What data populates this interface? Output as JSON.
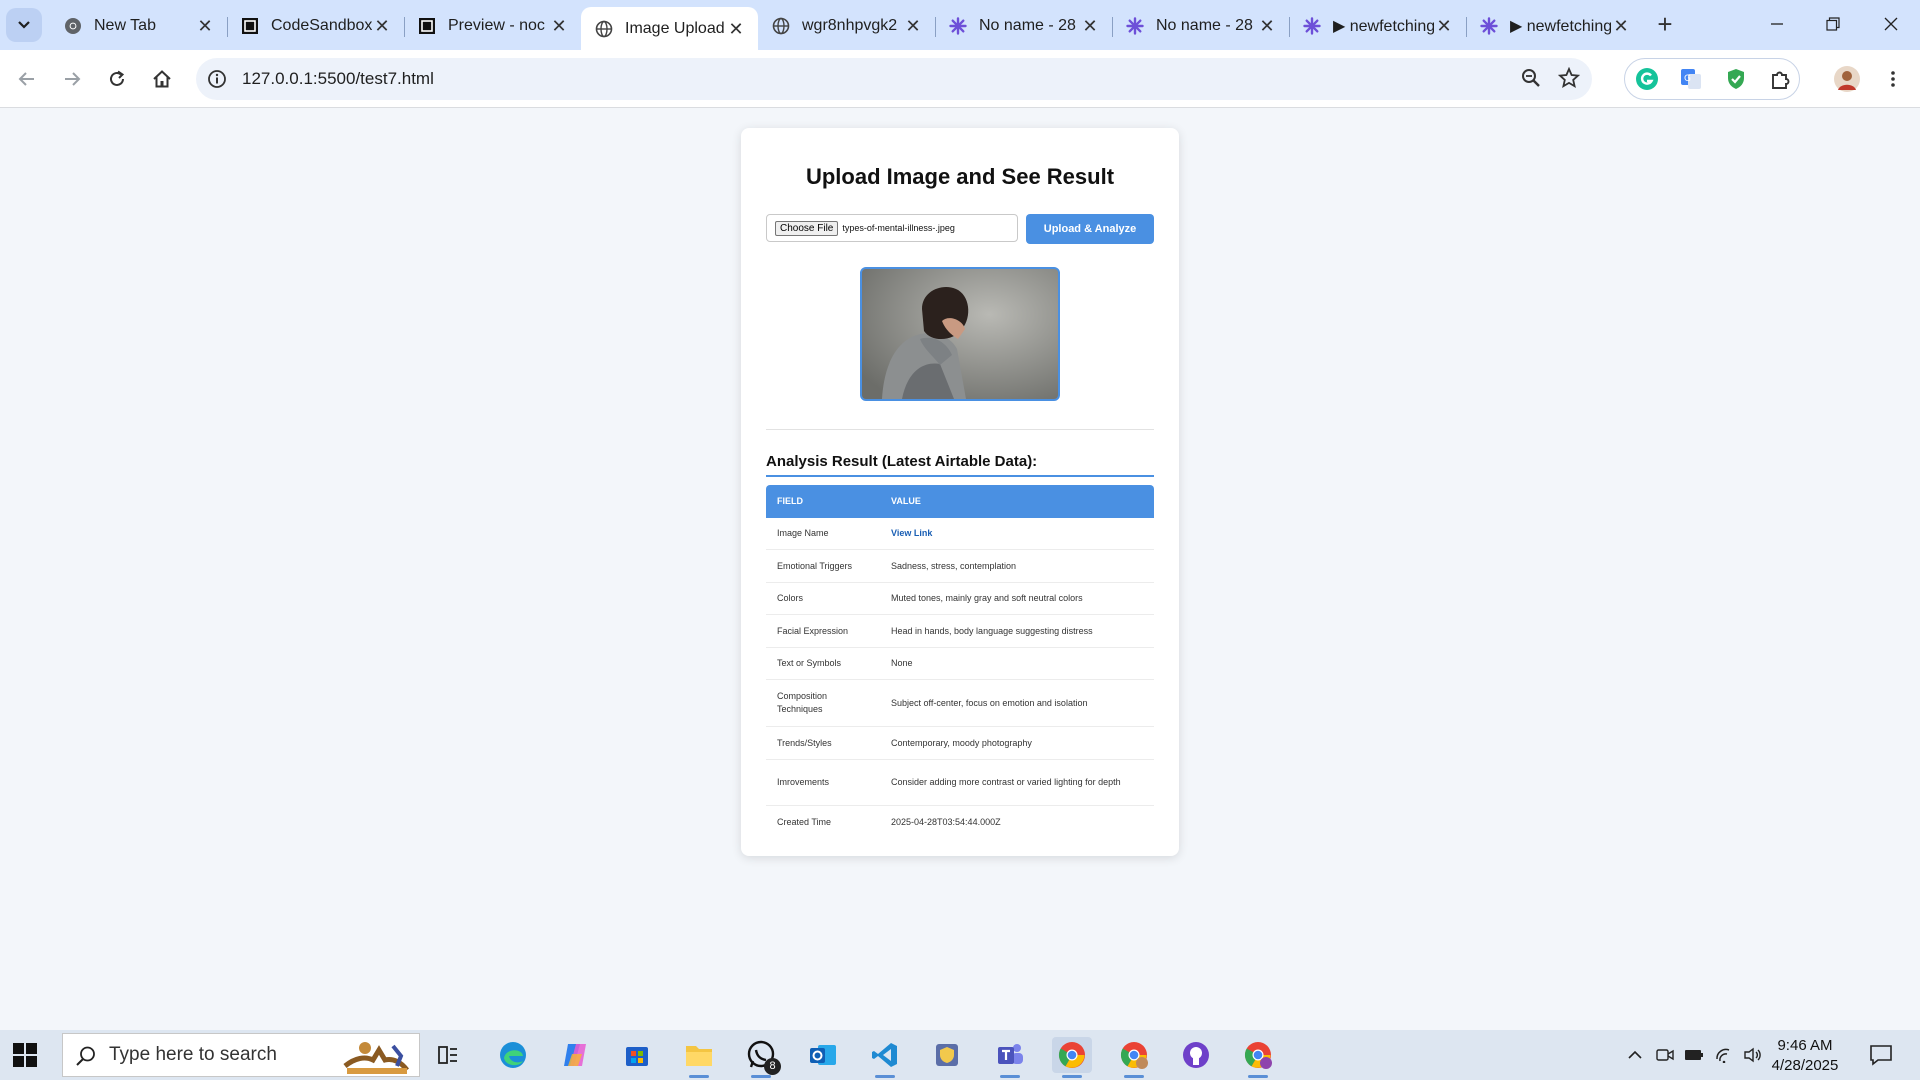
{
  "browser": {
    "tabs": [
      {
        "title": "New Tab",
        "icon": "chrome-icon",
        "active": false
      },
      {
        "title": "CodeSandbox",
        "icon": "codesandbox-icon",
        "active": false
      },
      {
        "title": "Preview - noc",
        "icon": "codesandbox-icon",
        "active": false
      },
      {
        "title": "Image Upload",
        "icon": "globe-icon",
        "active": true
      },
      {
        "title": "wgr8nhpvgk2",
        "icon": "globe-icon",
        "active": false
      },
      {
        "title": "No name - 28",
        "icon": "make-icon",
        "active": false
      },
      {
        "title": "No name - 28",
        "icon": "make-icon",
        "active": false
      },
      {
        "title": "▶ newfetching",
        "icon": "make-icon",
        "active": false
      },
      {
        "title": "▶ newfetching",
        "icon": "make-icon",
        "active": false
      }
    ],
    "url": "127.0.0.1:5500/test7.html"
  },
  "page": {
    "heading": "Upload Image and See Result",
    "choose_file_label": "Choose File",
    "selected_file": "types-of-mental-illness-.jpeg",
    "upload_button": "Upload & Analyze",
    "result_title": "Analysis Result (Latest Airtable Data):",
    "table": {
      "headers": [
        "FIELD",
        "VALUE"
      ],
      "rows": [
        {
          "field": "Image Name",
          "value": "View Link"
        },
        {
          "field": "Emotional Triggers",
          "value": "Sadness, stress, contemplation"
        },
        {
          "field": "Colors",
          "value": "Muted tones, mainly gray and soft neutral colors"
        },
        {
          "field": "Facial Expression",
          "value": "Head in hands, body language suggesting distress"
        },
        {
          "field": "Text or Symbols",
          "value": "None"
        },
        {
          "field": "Composition Techniques",
          "value": "Subject off-center, focus on emotion and isolation"
        },
        {
          "field": "Trends/Styles",
          "value": "Contemporary, moody photography"
        },
        {
          "field": "Imrovements",
          "value": "Consider adding more contrast or varied lighting for depth"
        },
        {
          "field": "Created Time",
          "value": "2025-04-28T03:54:44.000Z"
        }
      ]
    }
  },
  "taskbar": {
    "search_placeholder": "Type here to search",
    "whatsapp_badge": "8",
    "time": "9:46 AM",
    "date": "4/28/2025"
  },
  "colors": {
    "accent": "#4a90e2",
    "tabstrip": "#d3e3fd",
    "page_bg": "#f3f6fa"
  }
}
